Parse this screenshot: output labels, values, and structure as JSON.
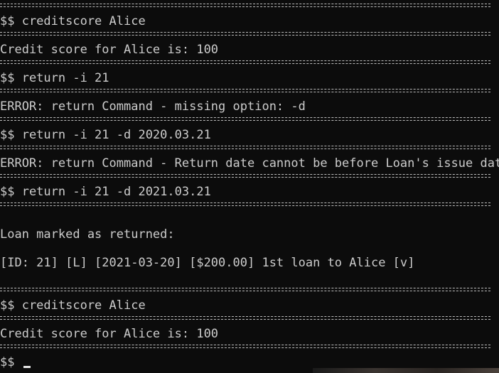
{
  "terminal": {
    "lines": [
      "$$ creditscore Alice",
      "Credit score for Alice is: 100",
      "$$ return -i 21",
      "ERROR: return Command - missing option: -d",
      "$$ return -i 21 -d 2020.03.21",
      "ERROR: return Command - Return date cannot be before Loan's issue date",
      "$$ return -i 21 -d 2021.03.21",
      "Loan marked as returned:",
      "[ID: 21] [L] [2021-03-20] [$200.00] 1st loan to Alice [v]",
      "$$ creditscore Alice",
      "Credit score for Alice is: 100",
      "$$ "
    ]
  }
}
